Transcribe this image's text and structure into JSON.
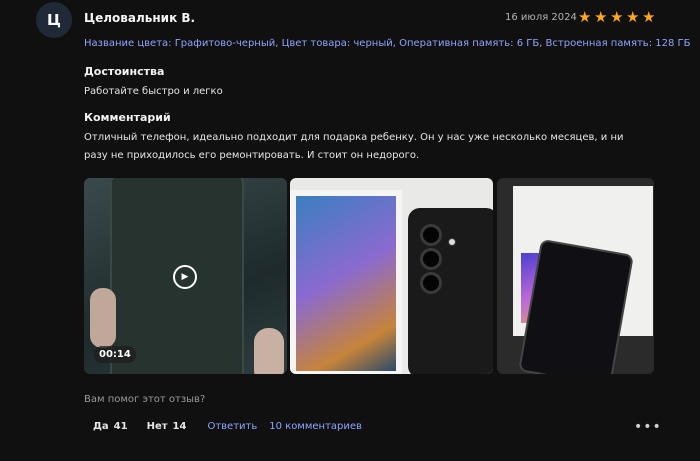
{
  "review": {
    "avatar_letter": "Ц",
    "author": "Целовальник В.",
    "date": "16 июля 2024",
    "rating": 5,
    "star_color": "#ffa51f",
    "attributes": "Название цвета: Графитово-черный, Цвет товара: черный, Оперативная память: 6 ГБ, Встроенная память: 128 ГБ",
    "pros_title": "Достоинства",
    "pros_text": "Работайте быстро и легко",
    "comment_title": "Комментарий",
    "comment_text": "Отличный телефон, идеально подходит для подарка ребенку. Он у нас уже несколько месяцев, и ни разу не приходилось его ремонтировать. И стоит он недорого."
  },
  "media": {
    "video_duration": "00:14"
  },
  "footer": {
    "helpful_question": "Вам помог этот отзыв?",
    "yes_label": "Да",
    "yes_count": "41",
    "no_label": "Нет",
    "no_count": "14",
    "reply_label": "Ответить",
    "comments_label": "10 комментариев",
    "more_glyph": "•••"
  },
  "colors": {
    "background": "#101010",
    "link": "#8fa4ff"
  }
}
